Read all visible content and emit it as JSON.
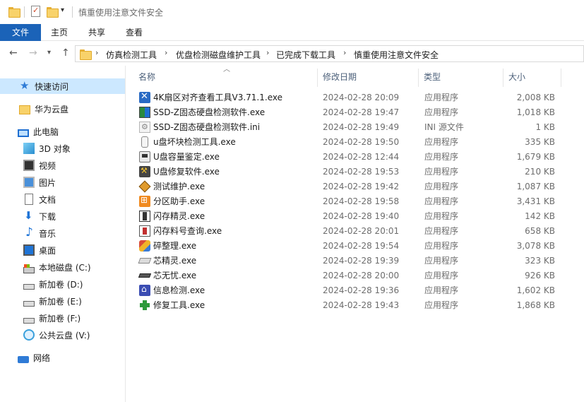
{
  "window": {
    "title": "慎重使用注意文件安全"
  },
  "ribbon": {
    "tabs": [
      {
        "label": "文件",
        "active": true
      },
      {
        "label": "主页"
      },
      {
        "label": "共享"
      },
      {
        "label": "查看"
      }
    ]
  },
  "address": {
    "breadcrumbs": [
      "仿真检测工具",
      "优盘检测磁盘维护工具",
      "已完成下载工具",
      "慎重使用注意文件安全"
    ]
  },
  "nav": {
    "quick_access": "快速访问",
    "huawei_cloud": "华为云盘",
    "this_pc": "此电脑",
    "items": [
      {
        "label": "3D 对象",
        "icon": "3d-objects-icon"
      },
      {
        "label": "视频",
        "icon": "video-icon"
      },
      {
        "label": "图片",
        "icon": "pictures-icon"
      },
      {
        "label": "文档",
        "icon": "documents-icon"
      },
      {
        "label": "下载",
        "icon": "downloads-icon"
      },
      {
        "label": "音乐",
        "icon": "music-icon"
      },
      {
        "label": "桌面",
        "icon": "desktop-icon"
      },
      {
        "label": "本地磁盘 (C:)",
        "icon": "local-disk-icon"
      },
      {
        "label": "新加卷 (D:)",
        "icon": "drive-icon"
      },
      {
        "label": "新加卷 (E:)",
        "icon": "drive-icon"
      },
      {
        "label": "新加卷 (F:)",
        "icon": "drive-icon"
      },
      {
        "label": "公共云盘 (V:)",
        "icon": "cloud-drive-icon"
      }
    ],
    "network": "网络"
  },
  "columns": {
    "name": "名称",
    "date": "修改日期",
    "type": "类型",
    "size": "大小"
  },
  "files": [
    {
      "name": "4K扇区对齐查看工具V3.71.1.exe",
      "date": "2024-02-28 20:09",
      "type": "应用程序",
      "size": "2,008 KB",
      "icon": "wrench-icon"
    },
    {
      "name": "SSD-Z固态硬盘检测软件.exe",
      "date": "2024-02-28 19:47",
      "type": "应用程序",
      "size": "1,018 KB",
      "icon": "ssd-icon"
    },
    {
      "name": "SSD-Z固态硬盘检测软件.ini",
      "date": "2024-02-28 19:49",
      "type": "INI 源文件",
      "size": "1 KB",
      "icon": "ini-file-icon"
    },
    {
      "name": "u盘坏块检测工具.exe",
      "date": "2024-02-28 19:50",
      "type": "应用程序",
      "size": "335 KB",
      "icon": "usb-icon"
    },
    {
      "name": "U盘容量鉴定.exe",
      "date": "2024-02-28 12:44",
      "type": "应用程序",
      "size": "1,679 KB",
      "icon": "disk-icon"
    },
    {
      "name": "U盘修复软件.exe",
      "date": "2024-02-28 19:53",
      "type": "应用程序",
      "size": "210 KB",
      "icon": "repair-icon"
    },
    {
      "name": "测试维护.exe",
      "date": "2024-02-28 19:42",
      "type": "应用程序",
      "size": "1,087 KB",
      "icon": "test-icon"
    },
    {
      "name": "分区助手.exe",
      "date": "2024-02-28 19:58",
      "type": "应用程序",
      "size": "3,431 KB",
      "icon": "partition-icon"
    },
    {
      "name": "闪存精灵.exe",
      "date": "2024-02-28 19:40",
      "type": "应用程序",
      "size": "142 KB",
      "icon": "flash-icon"
    },
    {
      "name": "闪存料号查询.exe",
      "date": "2024-02-28 20:01",
      "type": "应用程序",
      "size": "658 KB",
      "icon": "flash-query-icon"
    },
    {
      "name": "碎整理.exe",
      "date": "2024-02-28 19:54",
      "type": "应用程序",
      "size": "3,078 KB",
      "icon": "defrag-icon"
    },
    {
      "name": "芯精灵.exe",
      "date": "2024-02-28 19:39",
      "type": "应用程序",
      "size": "323 KB",
      "icon": "chip-icon"
    },
    {
      "name": "芯无忧.exe",
      "date": "2024-02-28 20:00",
      "type": "应用程序",
      "size": "926 KB",
      "icon": "chip-dark-icon"
    },
    {
      "name": "信息检测.exe",
      "date": "2024-02-28 19:36",
      "type": "应用程序",
      "size": "1,602 KB",
      "icon": "info-icon"
    },
    {
      "name": "修复工具.exe",
      "date": "2024-02-28 19:43",
      "type": "应用程序",
      "size": "1,868 KB",
      "icon": "green-cross-icon"
    }
  ]
}
